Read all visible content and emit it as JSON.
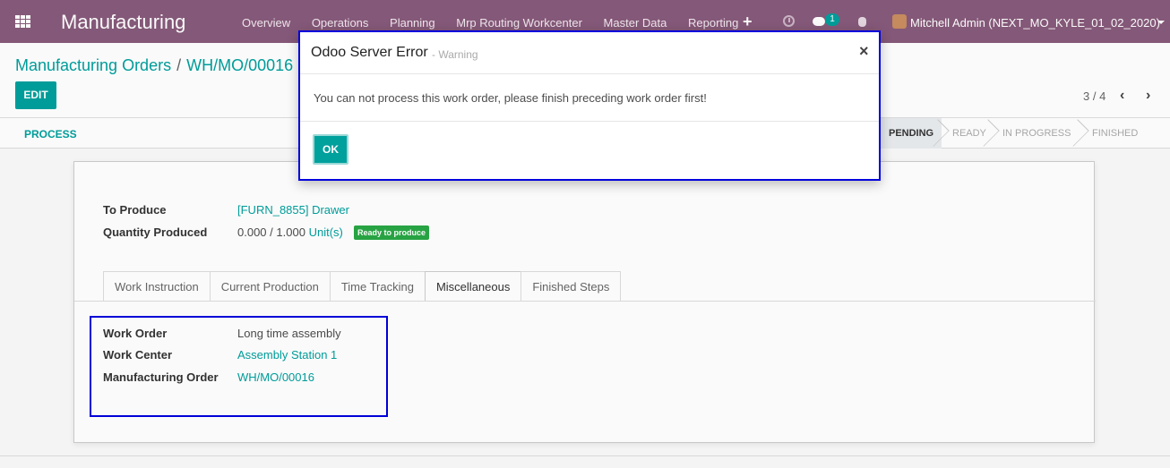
{
  "navbar": {
    "app_title": "Manufacturing",
    "menu": [
      "Overview",
      "Operations",
      "Planning",
      "Mrp Routing Workcenter",
      "Master Data",
      "Reporting"
    ],
    "plus_icon": "+",
    "chat_badge": "1",
    "user": "Mitchell Admin (NEXT_MO_KYLE_01_02_2020)"
  },
  "control": {
    "breadcrumb_parent": "Manufacturing Orders",
    "breadcrumb_sep": "/",
    "breadcrumb_current": "WH/MO/00016",
    "edit_label": "EDIT",
    "pager": "3 / 4",
    "prev_icon": "‹",
    "next_icon": "›"
  },
  "statusbar": {
    "process_label": "PROCESS",
    "stages": [
      "PENDING",
      "READY",
      "IN PROGRESS",
      "FINISHED"
    ],
    "active_stage": "PENDING"
  },
  "form": {
    "to_produce_label": "To Produce",
    "to_produce_value": "[FURN_8855] Drawer",
    "qty_label": "Quantity Produced",
    "qty_done": "0.000",
    "qty_sep": "/",
    "qty_total": "1.000",
    "qty_uom": "Unit(s)",
    "ready_badge": "Ready to produce",
    "tabs": [
      "Work Instruction",
      "Current Production",
      "Time Tracking",
      "Miscellaneous",
      "Finished Steps"
    ],
    "active_tab": "Miscellaneous",
    "work_order_label": "Work Order",
    "work_order_value": "Long time assembly",
    "work_center_label": "Work Center",
    "work_center_value": "Assembly Station 1",
    "mo_label": "Manufacturing Order",
    "mo_value": "WH/MO/00016"
  },
  "modal": {
    "title": "Odoo Server Error",
    "subtitle": "- Warning",
    "close_icon": "×",
    "message": "You can not process this work order, please finish preceding work order first!",
    "ok_label": "OK"
  },
  "colors": {
    "navbar": "#875a7b",
    "accent": "#00a09d",
    "highlight": "#0000dd",
    "badge_green": "#28a745"
  }
}
